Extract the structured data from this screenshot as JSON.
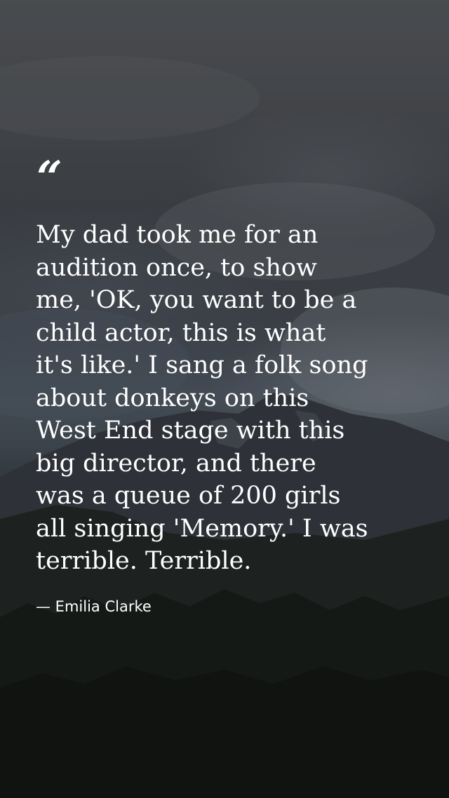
{
  "quote": {
    "mark": "“",
    "text": "My dad took me for an\naudition once, to show\nme, 'OK, you want to be a\nchild actor, this is what\nit's like.' I sang a folk song\nabout donkeys on this\nWest End stage with this\nbig director, and there\nwas a queue of 200 girls\nall singing 'Memory.' I was\nterrible. Terrible.",
    "author": "— Emilia Clarke"
  },
  "background": {
    "description_colors": {
      "sky": "#54585e",
      "mountain": "#3f454c",
      "forest": "#1b1f1c"
    }
  }
}
